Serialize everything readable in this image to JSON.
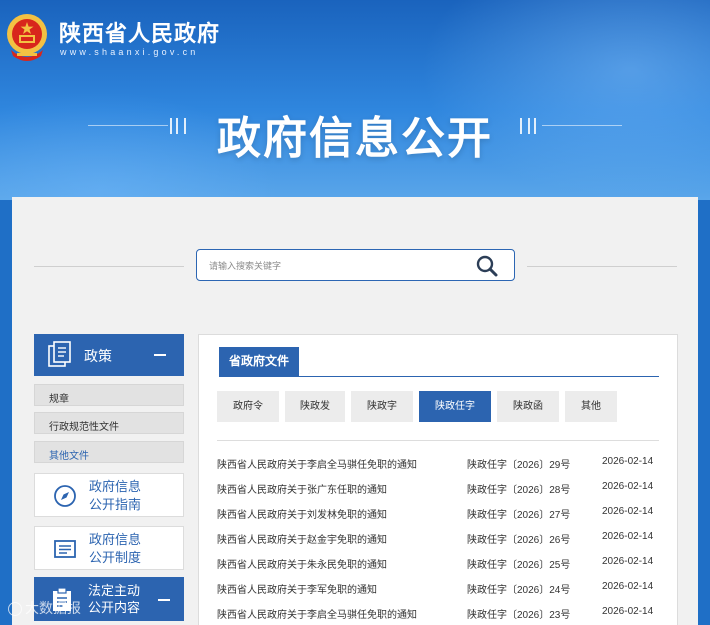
{
  "header": {
    "site_title": "陕西省人民政府",
    "site_url": "www.shaanxi.gov.cn",
    "banner_title": "政府信息公开"
  },
  "search": {
    "placeholder": "请输入搜索关键字"
  },
  "sidebar": {
    "section_title": "政策",
    "items": [
      {
        "label": "规章"
      },
      {
        "label": "行政规范性文件"
      },
      {
        "label": "其他文件"
      }
    ],
    "cards": [
      {
        "line1": "政府信息",
        "line2": "公开指南"
      },
      {
        "line1": "政府信息",
        "line2": "公开制度"
      }
    ],
    "section2_title_line1": "法定主动",
    "section2_title_line2": "公开内容"
  },
  "content": {
    "tab_label": "省政府文件",
    "filters": [
      {
        "label": "政府令"
      },
      {
        "label": "陕政发"
      },
      {
        "label": "陕政字"
      },
      {
        "label": "陕政任字"
      },
      {
        "label": "陕政函"
      },
      {
        "label": "其他"
      }
    ],
    "active_filter": "陕政任字",
    "rows": [
      {
        "title": "陕西省人民政府关于李启全马骐任免职的通知",
        "number": "陕政任字〔2026〕29号",
        "date": "2026-02-14"
      },
      {
        "title": "陕西省人民政府关于张广东任职的通知",
        "number": "陕政任字〔2026〕28号",
        "date": "2026-02-14"
      },
      {
        "title": "陕西省人民政府关于刘发林免职的通知",
        "number": "陕政任字〔2026〕27号",
        "date": "2026-02-14"
      },
      {
        "title": "陕西省人民政府关于赵金宇免职的通知",
        "number": "陕政任字〔2026〕26号",
        "date": "2026-02-14"
      },
      {
        "title": "陕西省人民政府关于朱永民免职的通知",
        "number": "陕政任字〔2026〕25号",
        "date": "2026-02-14"
      },
      {
        "title": "陕西省人民政府关于李军免职的通知",
        "number": "陕政任字〔2026〕24号",
        "date": "2026-02-14"
      },
      {
        "title": "陕西省人民政府关于李启全马骐任免职的通知",
        "number": "陕政任字〔2026〕23号",
        "date": "2026-02-14"
      }
    ]
  },
  "watermark": "大数据报",
  "colors": {
    "brand_blue": "#2c64b0",
    "banner_blue": "#1f6fc6",
    "emblem_red": "#d8261c",
    "emblem_gold": "#f3c143"
  }
}
